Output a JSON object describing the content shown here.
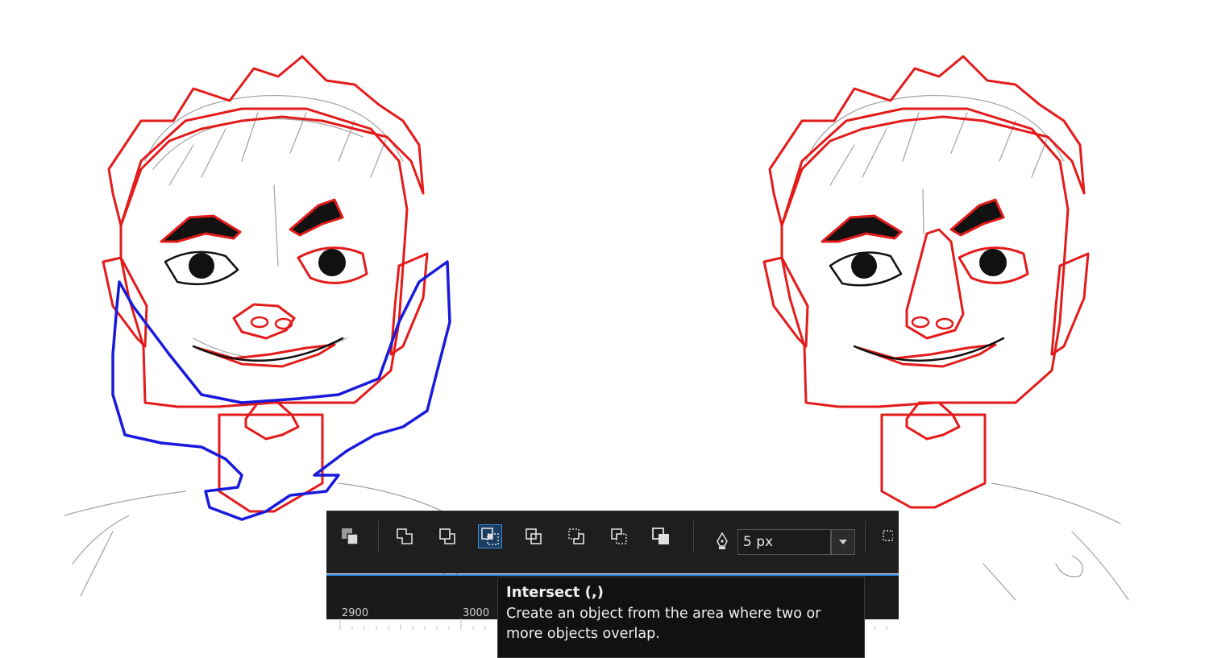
{
  "colors": {
    "outline_red": "#e31b1b",
    "outline_blue": "#1a1adb",
    "toolbar_bg": "#1e1e1e",
    "active_blue": "#2b7fd4"
  },
  "toolbar": {
    "buttons": [
      {
        "name": "arrange-order-icon"
      },
      {
        "name": "weld-icon"
      },
      {
        "name": "trim-icon"
      },
      {
        "name": "intersect-icon",
        "active": true
      },
      {
        "name": "simplify-icon"
      },
      {
        "name": "front-minus-back-icon"
      },
      {
        "name": "back-minus-front-icon"
      },
      {
        "name": "create-boundary-icon"
      }
    ],
    "outline_width": "5 px"
  },
  "ruler": {
    "labels": [
      "2900",
      "3000"
    ]
  },
  "tooltip": {
    "title": "Intersect (,)",
    "description_line1": "Create an object from the area where two or",
    "description_line2": "more objects overlap."
  }
}
